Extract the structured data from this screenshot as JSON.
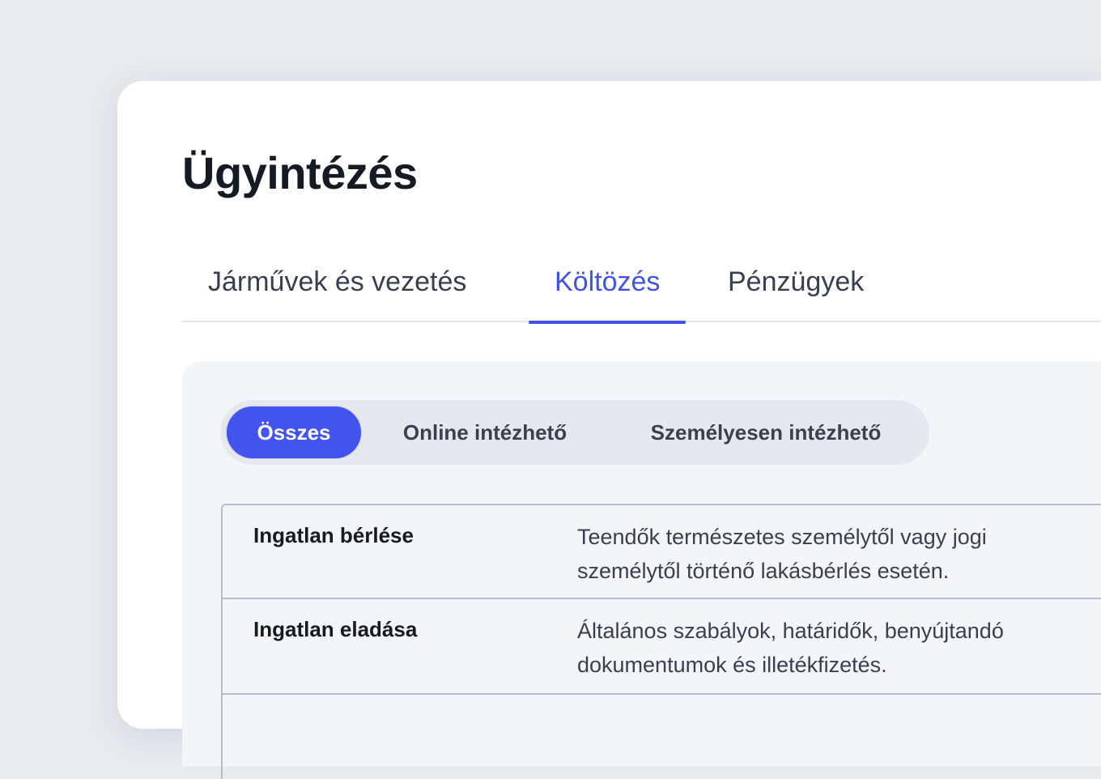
{
  "page": {
    "title": "Ügyintézés"
  },
  "tabs": [
    {
      "label": "Járművek és vezetés",
      "active": false
    },
    {
      "label": "Költözés",
      "active": true
    },
    {
      "label": "Pénzügyek",
      "active": false
    }
  ],
  "filters": [
    {
      "label": "Összes",
      "active": true
    },
    {
      "label": "Online intézhető",
      "active": false
    },
    {
      "label": "Személyesen intézhető",
      "active": false
    }
  ],
  "items": [
    {
      "title": "Ingatlan bérlése",
      "description": "Teendők természetes személytől vagy jogi személytől történő lakásbérlés esetén."
    },
    {
      "title": "Ingatlan eladása",
      "description": "Általános szabályok, határidők, benyújtandó dokumentumok és illetékfizetés."
    }
  ],
  "colors": {
    "accent": "#4254ec",
    "background": "#e8eaee",
    "panel": "#f4f5f9",
    "text": "#161a23"
  }
}
